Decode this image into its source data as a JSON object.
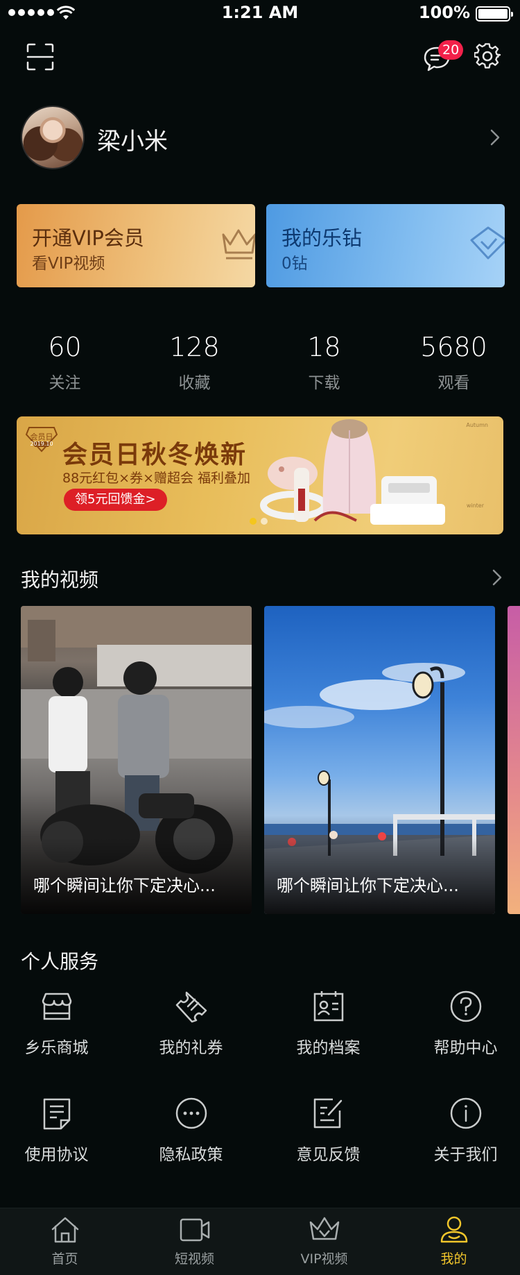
{
  "status_bar": {
    "time": "1:21 AM",
    "battery": "100%"
  },
  "header": {
    "message_badge": "20"
  },
  "profile": {
    "name": "梁小米"
  },
  "cards": {
    "vip": {
      "title": "开通VIP会员",
      "subtitle": "看VIP视频"
    },
    "diamond": {
      "title": "我的乐钻",
      "subtitle": "0钻"
    }
  },
  "stats": [
    {
      "value": "60",
      "label": "关注"
    },
    {
      "value": "128",
      "label": "收藏"
    },
    {
      "value": "18",
      "label": "下载"
    },
    {
      "value": "5680",
      "label": "观看"
    }
  ],
  "banner": {
    "badge": "会员日",
    "badge_year": "2019.10",
    "title": "会员日秋冬焕新",
    "subtitle": "88元红包×券×赠超会 福利叠加",
    "button": "领5元回馈金>",
    "side_top": "Autumn",
    "side_bottom": "winter"
  },
  "my_video": {
    "title": "我的视频",
    "items": [
      {
        "caption": "哪个瞬间让你下定决心..."
      },
      {
        "caption": "哪个瞬间让你下定决心..."
      }
    ]
  },
  "services": {
    "title": "个人服务",
    "items": [
      {
        "label": "乡乐商城",
        "icon": "store-icon"
      },
      {
        "label": "我的礼券",
        "icon": "ticket-icon"
      },
      {
        "label": "我的档案",
        "icon": "profile-card-icon"
      },
      {
        "label": "帮助中心",
        "icon": "help-icon"
      },
      {
        "label": "使用协议",
        "icon": "document-icon"
      },
      {
        "label": "隐私政策",
        "icon": "more-icon"
      },
      {
        "label": "意见反馈",
        "icon": "feedback-icon"
      },
      {
        "label": "关于我们",
        "icon": "info-icon"
      }
    ]
  },
  "tabbar": {
    "items": [
      {
        "label": "首页",
        "icon": "home-icon"
      },
      {
        "label": "短视频",
        "icon": "video-camera-icon"
      },
      {
        "label": "VIP视频",
        "icon": "crown-icon"
      },
      {
        "label": "我的",
        "icon": "user-icon"
      }
    ],
    "active_index": 3
  },
  "colors": {
    "background": "#050b0b",
    "accent": "#f2c62b",
    "badge": "#f2214a"
  }
}
